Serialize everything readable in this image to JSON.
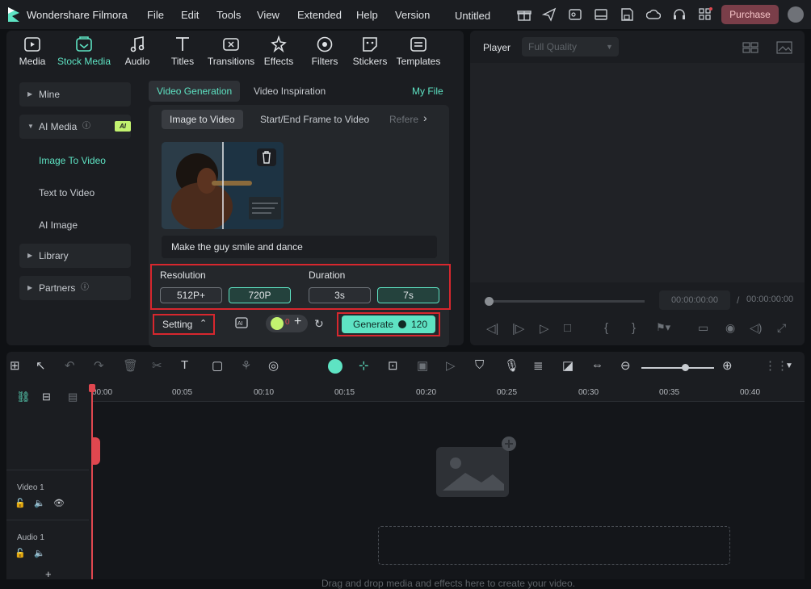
{
  "app": {
    "name": "Wondershare Filmora",
    "document_title": "Untitled",
    "purchase_label": "Purchase"
  },
  "menu": [
    "File",
    "Edit",
    "Tools",
    "View",
    "Extended",
    "Help",
    "Version"
  ],
  "media_tabs": [
    {
      "label": "Media",
      "icon": "media-icon",
      "active": false
    },
    {
      "label": "Stock Media",
      "icon": "stock-media-icon",
      "active": true
    },
    {
      "label": "Audio",
      "icon": "music-note-icon",
      "active": false
    },
    {
      "label": "Titles",
      "icon": "titles-icon",
      "active": false
    },
    {
      "label": "Transitions",
      "icon": "transitions-icon",
      "active": false
    },
    {
      "label": "Effects",
      "icon": "effects-icon",
      "active": false
    },
    {
      "label": "Filters",
      "icon": "filters-icon",
      "active": false
    },
    {
      "label": "Stickers",
      "icon": "stickers-icon",
      "active": false
    },
    {
      "label": "Templates",
      "icon": "templates-icon",
      "active": false
    }
  ],
  "sidebar": {
    "mine": "Mine",
    "ai_media": "AI Media",
    "ai_badge": "AI",
    "image_to_video": "Image To Video",
    "text_to_video": "Text to Video",
    "ai_image": "AI Image",
    "library": "Library",
    "partners": "Partners"
  },
  "content": {
    "tab_video_generation": "Video Generation",
    "tab_video_inspiration": "Video Inspiration",
    "my_file": "My File",
    "subtab_image_to_video": "Image to Video",
    "subtab_start_end": "Start/End Frame to Video",
    "subtab_reference": "Refere",
    "prompt": "Make the guy smile and dance"
  },
  "settings": {
    "resolution_label": "Resolution",
    "resolution_options": [
      "512P+",
      "720P"
    ],
    "resolution_selected": "720P",
    "duration_label": "Duration",
    "duration_options": [
      "3s",
      "7s"
    ],
    "duration_selected": "7s",
    "setting_label": "Setting",
    "generate_label": "Generate",
    "generate_cost": "120",
    "credit_count": "0"
  },
  "player": {
    "title": "Player",
    "quality": "Full Quality",
    "current_time": "00:00:00:00",
    "separator": "/",
    "total_time": "00:00:00:00"
  },
  "timeline": {
    "ticks": [
      "00:00",
      "00:05",
      "00:10",
      "00:15",
      "00:20",
      "00:25",
      "00:30",
      "00:35",
      "00:40"
    ],
    "tracks": [
      {
        "label": "Video 1"
      },
      {
        "label": "Audio 1"
      }
    ],
    "drop_hint": "Drag and drop media and effects here to create your video."
  },
  "colors": {
    "accent": "#5ee3c3",
    "highlight_box": "#d7272e",
    "purchase_bg": "#7a3e49",
    "ai_badge": "#c2f26f"
  }
}
